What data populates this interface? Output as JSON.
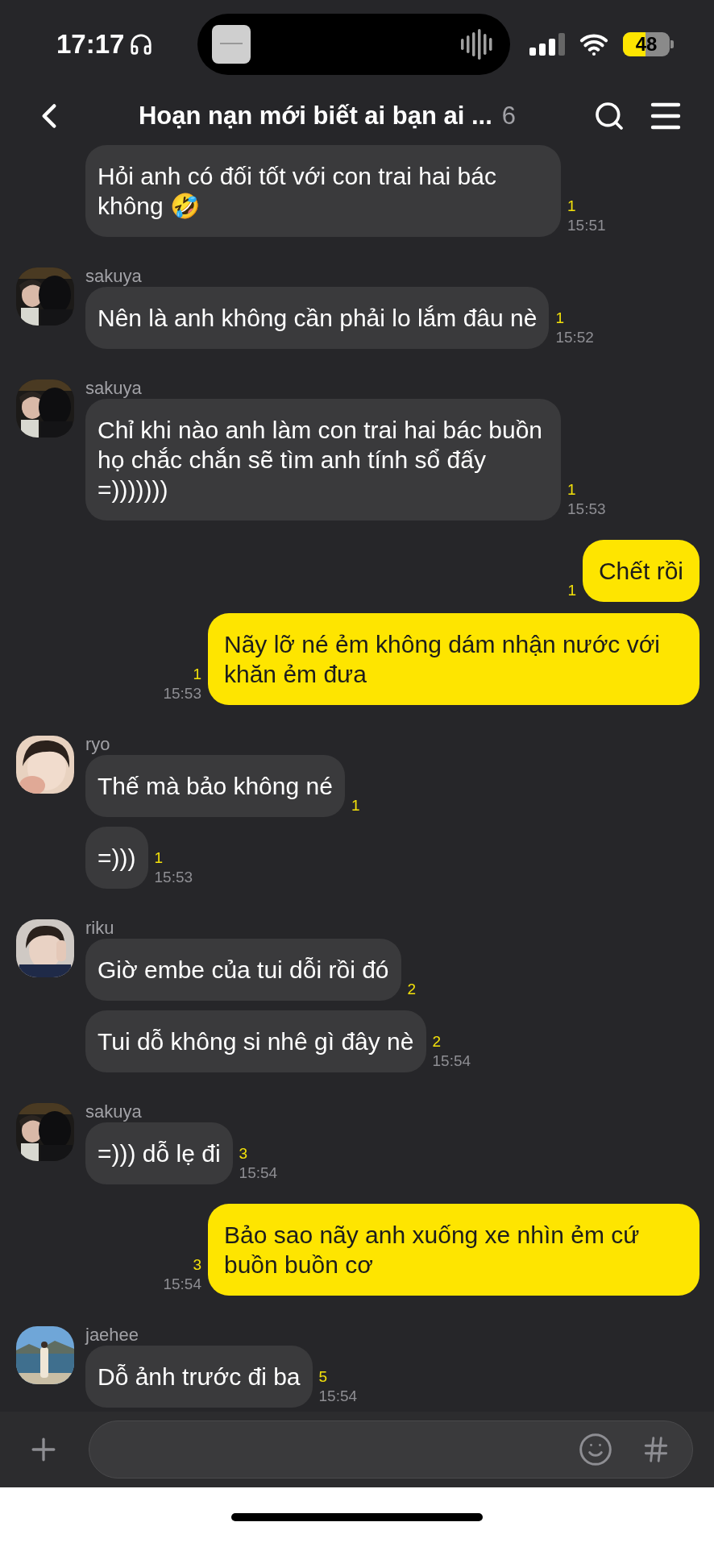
{
  "status_bar": {
    "time": "17:17",
    "battery": "48"
  },
  "header": {
    "title": "Hoạn nạn mới biết ai bạn ai ...",
    "member_count": "6"
  },
  "groups": [
    {
      "kind": "received",
      "messages": [
        {
          "text": "Hỏi anh có đối tốt với con trai hai bác không 🤣",
          "unread": "1",
          "time": "15:51"
        }
      ]
    },
    {
      "kind": "received",
      "sender": "sakuya",
      "avatar": {
        "kind": "picture"
      },
      "messages": [
        {
          "text": "Nên là anh không cần phải lo lắm đâu nè",
          "unread": "1",
          "time": "15:52"
        }
      ]
    },
    {
      "kind": "received",
      "sender": "sakuya",
      "avatar": {
        "kind": "picture"
      },
      "messages": [
        {
          "text": "Chỉ khi nào anh làm con trai hai bác buồn họ chắc chắn sẽ tìm anh tính sổ đấy =)))))))",
          "unread": "1",
          "time": "15:53"
        }
      ]
    },
    {
      "kind": "sent",
      "messages": [
        {
          "text": "Chết rồi",
          "unread": "1"
        }
      ]
    },
    {
      "kind": "sent",
      "messages": [
        {
          "text": "Nãy lỡ né ẻm không dám nhận nước với khăn ẻm đưa",
          "unread": "1",
          "time": "15:53"
        }
      ]
    },
    {
      "kind": "received",
      "sender": "ryo",
      "avatar": {
        "kind": "picture"
      },
      "messages": [
        {
          "text": "Thế mà bảo không né",
          "unread": "1"
        },
        {
          "text": "=)))",
          "unread": "1",
          "time": "15:53"
        }
      ]
    },
    {
      "kind": "received",
      "sender": "riku",
      "avatar": {
        "kind": "picture"
      },
      "messages": [
        {
          "text": "Giờ embe của tui dỗi rồi đó",
          "unread": "2"
        },
        {
          "text": "Tui dỗ không si nhê gì đây nè",
          "unread": "2",
          "time": "15:54"
        }
      ]
    },
    {
      "kind": "received",
      "sender": "sakuya",
      "avatar": {
        "kind": "picture"
      },
      "messages": [
        {
          "text": "=))) dỗ lẹ đi",
          "unread": "3",
          "time": "15:54"
        }
      ]
    },
    {
      "kind": "sent",
      "messages": [
        {
          "text": "Bảo sao nãy anh xuống xe nhìn ẻm cứ buồn buồn cơ",
          "unread": "3",
          "time": "15:54"
        }
      ]
    },
    {
      "kind": "received",
      "sender": "jaehee",
      "avatar": {
        "kind": "picture"
      },
      "messages": [
        {
          "text": "Dỗ ảnh trước đi ba",
          "unread": "5",
          "time": "15:54"
        }
      ]
    }
  ]
}
